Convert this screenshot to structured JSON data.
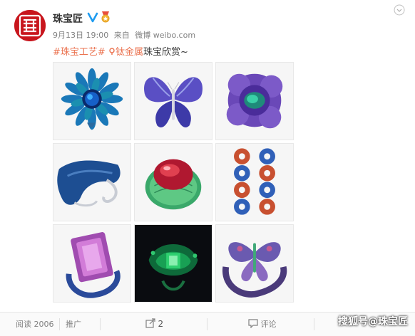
{
  "post": {
    "author": "珠宝匠",
    "time": "9月13日 19:00",
    "source_prefix": "来自",
    "source": "微博 weibo.com",
    "topic": "#珠宝工艺#",
    "link_text": "钛金属",
    "suffix": "珠宝欣赏~"
  },
  "footer": {
    "reads": "阅读 2006",
    "promote": "推广",
    "shares": "2",
    "comments": "评论"
  },
  "watermark": "搜狐号@珠宝匠",
  "images": [
    "blue-flower-brooch",
    "butterfly-brooch",
    "purple-flower-ring",
    "blue-bangle",
    "red-cabochon-ring",
    "ring-earrings",
    "pink-gem-ring",
    "green-emerald-ring",
    "dragonfly-cuff"
  ],
  "colors": {
    "accent": "#eb7350",
    "brand": "#c8161d"
  }
}
